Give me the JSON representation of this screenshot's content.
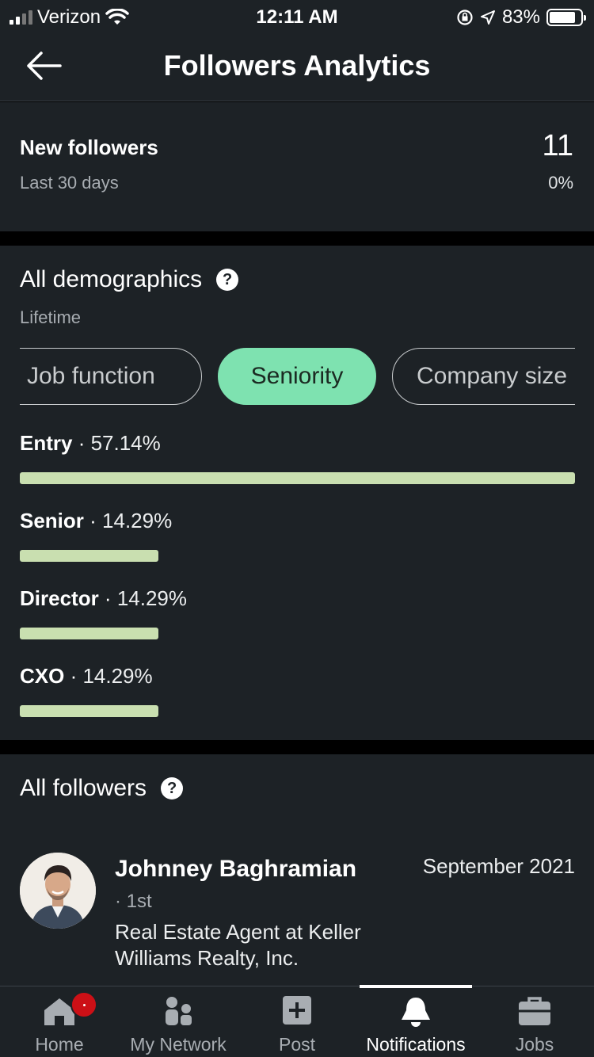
{
  "status_bar": {
    "carrier": "Verizon",
    "time": "12:11 AM",
    "battery_percent": "83%",
    "battery_level": 0.83,
    "icons": [
      "signal-icon",
      "wifi-icon",
      "orientation-lock-icon",
      "location-icon",
      "battery-icon"
    ]
  },
  "header": {
    "title": "Followers Analytics",
    "back_icon": "arrow-left-icon"
  },
  "new_followers": {
    "label": "New followers",
    "period": "Last 30 days",
    "value": "11",
    "change": "0%"
  },
  "demographics": {
    "title": "All demographics",
    "period": "Lifetime",
    "tabs": [
      {
        "label": "Job function",
        "selected": false
      },
      {
        "label": "Seniority",
        "selected": true
      },
      {
        "label": "Company size",
        "selected": false
      }
    ],
    "rows": [
      {
        "label": "Entry",
        "separator": " · ",
        "percent": "57.14%",
        "fraction": 1.0
      },
      {
        "label": "Senior",
        "separator": " · ",
        "percent": "14.29%",
        "fraction": 0.25
      },
      {
        "label": "Director",
        "separator": " · ",
        "percent": "14.29%",
        "fraction": 0.25
      },
      {
        "label": "CXO",
        "separator": " · ",
        "percent": "14.29%",
        "fraction": 0.25
      }
    ],
    "bar_color": "#c9dfb0",
    "selected_tab_color": "#7ee2b0"
  },
  "followers": {
    "title": "All followers",
    "items": [
      {
        "name": "Johnney Baghramian",
        "degree": "· 1st",
        "headline": "Real Estate Agent at Keller Williams Realty, Inc.",
        "date": "September 2021"
      }
    ]
  },
  "tab_bar": {
    "items": [
      {
        "label": "Home",
        "icon": "home-icon",
        "active": false,
        "badge": true
      },
      {
        "label": "My Network",
        "icon": "network-icon",
        "active": false
      },
      {
        "label": "Post",
        "icon": "post-plus-icon",
        "active": false
      },
      {
        "label": "Notifications",
        "icon": "bell-icon",
        "active": true
      },
      {
        "label": "Jobs",
        "icon": "briefcase-icon",
        "active": false
      }
    ]
  }
}
